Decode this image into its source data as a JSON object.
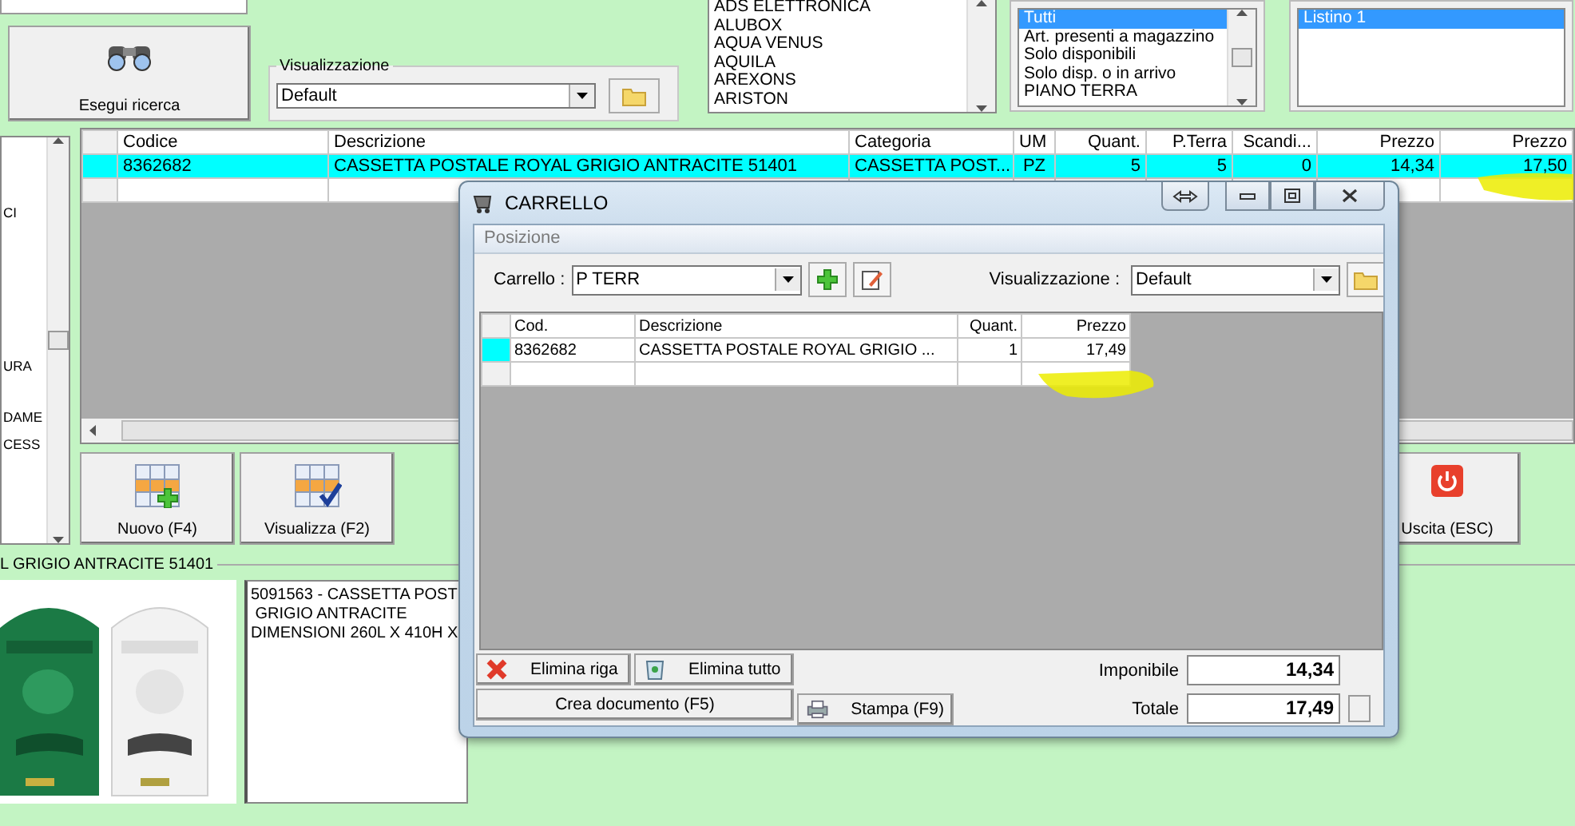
{
  "search_button": {
    "label": "Esegui ricerca"
  },
  "view_group": {
    "title": "Visualizzazione",
    "value": "Default"
  },
  "brand_list": {
    "items": [
      {
        "label": "ADS ELETTRONICA",
        "selected": false
      },
      {
        "label": "ALUBOX",
        "selected": false
      },
      {
        "label": "AQUA  VENUS",
        "selected": false
      },
      {
        "label": "AQUILA",
        "selected": false
      },
      {
        "label": "AREXONS",
        "selected": false
      },
      {
        "label": "ARISTON",
        "selected": false
      }
    ]
  },
  "quantity_list": {
    "items": [
      {
        "label": "Tutti",
        "selected": true
      },
      {
        "label": "Art. presenti a magazzino",
        "selected": false
      },
      {
        "label": "Solo disponibili",
        "selected": false
      },
      {
        "label": "Solo disp. o in arrivo",
        "selected": false
      },
      {
        "label": "PIANO TERRA",
        "selected": false
      }
    ]
  },
  "price_list": {
    "items": [
      {
        "label": "Listino 1",
        "selected": true
      }
    ]
  },
  "side_list": {
    "items": [
      "CI",
      "URA",
      "DAME",
      "CESS"
    ]
  },
  "table": {
    "columns": [
      "Codice",
      "Descrizione",
      "Categoria",
      "UM",
      "Quant.",
      "P.Terra",
      "Scandi...",
      "Prezzo",
      "Prezzo"
    ],
    "rows": [
      {
        "selected": true,
        "cells": [
          "8362682",
          "CASSETTA POSTALE ROYAL GRIGIO ANTRACITE 51401",
          "CASSETTA POST...",
          "PZ",
          "5",
          "5",
          "0",
          "14,34",
          "17,50"
        ]
      }
    ]
  },
  "actions": [
    {
      "kind": "new",
      "label": "Nuovo (F4)"
    },
    {
      "kind": "view",
      "label": "Visualizza (F2)"
    },
    {
      "kind": "exit",
      "label": "Uscita (ESC)"
    }
  ],
  "detail": {
    "title": "L GRIGIO ANTRACITE 51401",
    "lines": [
      "5091563 - CASSETTA POST",
      " GRIGIO ANTRACITE",
      "DIMENSIONI 260L X 410H X"
    ]
  },
  "cart_dialog": {
    "title": "CARRELLO",
    "section": "Posizione",
    "cart_label": "Carrello :",
    "cart_value": "P TERR",
    "view_label": "Visualizzazione :",
    "view_value": "Default",
    "columns": [
      "Cod.",
      "Descrizione",
      "Quant.",
      "Prezzo"
    ],
    "rows": [
      {
        "selected": true,
        "cells": [
          "8362682",
          "CASSETTA POSTALE ROYAL GRIGIO ...",
          "1",
          "17,49"
        ]
      }
    ],
    "buttons": [
      {
        "kind": "delete",
        "label": "Elimina riga"
      },
      {
        "kind": "clear",
        "label": "Elimina tutto"
      },
      {
        "kind": "plain",
        "label": "Crea documento (F5)"
      },
      {
        "kind": "print",
        "label": "Stampa (F9)"
      }
    ],
    "taxable_label": "Imponibile",
    "taxable": "14,34",
    "total_label": "Totale",
    "total": "17,49"
  }
}
